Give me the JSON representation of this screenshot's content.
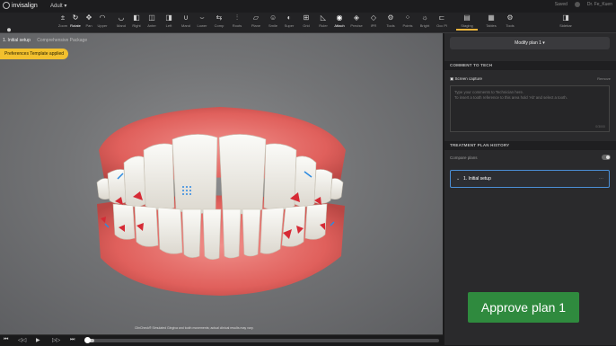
{
  "app": {
    "name": "invisalign",
    "mode": "Adult"
  },
  "top_right": {
    "saved": "Saved",
    "user": "Dr. Fe_Kuen"
  },
  "left_rail": {
    "label": "Menu"
  },
  "toolbar": {
    "tools": [
      {
        "label": "Zoom",
        "icon": "zoom-icon"
      },
      {
        "label": "Rotate",
        "icon": "rotate-icon"
      },
      {
        "label": "Pan",
        "icon": "pan-icon"
      },
      {
        "label": "Upper",
        "icon": "upper-arch-icon"
      },
      {
        "label": "Mand",
        "icon": "mand-icon"
      },
      {
        "label": "Right",
        "icon": "right-view-icon"
      },
      {
        "label": "Anter",
        "icon": "anterior-view-icon"
      },
      {
        "label": "Left",
        "icon": "left-view-icon"
      },
      {
        "label": "Mand",
        "icon": "mandibular-icon"
      },
      {
        "label": "Lower",
        "icon": "lower-arch-icon"
      },
      {
        "label": "Comp",
        "icon": "compare-icon"
      },
      {
        "label": "Roots",
        "icon": "roots-icon"
      },
      {
        "label": "Plane",
        "icon": "plane-icon"
      },
      {
        "label": "Smile",
        "icon": "smile-icon"
      },
      {
        "label": "Super",
        "icon": "superimpose-icon"
      },
      {
        "label": "Grid",
        "icon": "grid-icon"
      },
      {
        "label": "Ruler",
        "icon": "ruler-icon"
      },
      {
        "label": "Attach",
        "icon": "attach-icon"
      },
      {
        "label": "Precise",
        "icon": "precise-icon"
      },
      {
        "label": "IPR",
        "icon": "ipr-icon"
      },
      {
        "label": "Tools",
        "icon": "tools-icon"
      },
      {
        "label": "Points",
        "icon": "points-icon"
      },
      {
        "label": "Bright",
        "icon": "bright-icon"
      },
      {
        "label": "Occ Pl",
        "icon": "occlusal-plane-icon"
      },
      {
        "label": "Staging",
        "icon": "staging-icon"
      },
      {
        "label": "Tables",
        "icon": "tables-icon"
      },
      {
        "label": "Tools",
        "icon": "tools-icon"
      },
      {
        "label": "Sidebar",
        "icon": "sidebar-icon"
      }
    ]
  },
  "viewport": {
    "breadcrumb": "1. Initial setup",
    "breadcrumb_sub": "Comprehensive Package",
    "badge": "Preferences Template applied",
    "disclaimer": "ClinCheck® Simulated Gingiva and tooth movements; actual clinical results may vary."
  },
  "playback": {
    "progress": 0.02
  },
  "panel": {
    "modify_label": "Modify plan 1",
    "comment_header": "COMMENT TO TECH",
    "screen_capture": "Screen capture",
    "remove": "Remove",
    "comment_placeholder_1": "Type your comments to Technician here.",
    "comment_placeholder_2": "To insert a tooth reference to this area hold 'Alt' and select a tooth.",
    "char_count": "0/3000",
    "history_header": "TREATMENT PLAN HISTORY",
    "compare_label": "Compare plans",
    "plan_item": "1. Initial setup",
    "approve_label": "Approve plan 1"
  },
  "colors": {
    "badge": "#f2c02e",
    "approve": "#2f8a3e",
    "selected_border": "#4b8fd6"
  }
}
